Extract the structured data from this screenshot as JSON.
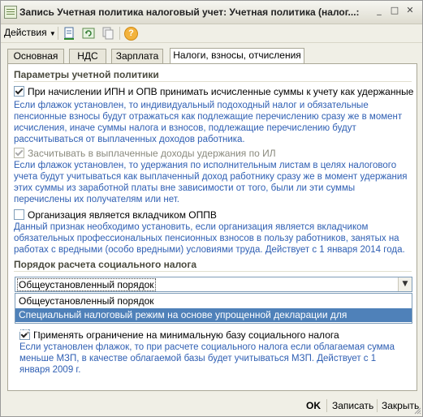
{
  "window": {
    "title": "Запись Учетная политика налоговый учет: Учетная политика (налог...:"
  },
  "toolbar": {
    "actions_label": "Действия"
  },
  "tabs": [
    {
      "label": "Основная",
      "active": false
    },
    {
      "label": "НДС",
      "active": false
    },
    {
      "label": "Зарплата",
      "active": false
    },
    {
      "label": "Налоги, взносы, отчисления",
      "active": true
    }
  ],
  "policy": {
    "section_title": "Параметры учетной политики",
    "ipn_checkbox": {
      "label": "При начислении ИПН и ОПВ принимать исчисленные суммы к учету как удержанные",
      "checked": true
    },
    "ipn_hint": [
      "Если флажок установлен, то индивидуальный подоходный налог и обязательные",
      "пенсионные взносы будут отражаться как подлежащие перечислению сразу же в момент",
      "исчисления, иначе суммы налога и взносов, подлежащие перечислению будут",
      "рассчитываться от выплаченных доходов работника."
    ],
    "il_checkbox": {
      "label": "Засчитывать в выплаченные доходы удержания по ИЛ",
      "checked": true
    },
    "il_hint": [
      "Если флажок установлен, то удержания по исполнительным листам в целях налогового",
      "учета будут учитываться как выплаченный доход работнику сразу же в момент удержания",
      "этих суммы из заработной платы вне зависимости от того, были ли эти суммы",
      "перечислены их получателям или нет."
    ],
    "oppv_checkbox": {
      "label": "Организация является вкладчиком ОППВ",
      "checked": false
    },
    "oppv_hint": [
      "Данный признак необходимо установить, если организация является вкладчиком",
      "обязательных профессиональных пенсионных взносов в пользу работников, занятых на",
      "работах с вредными (особо вредными) условиями труда. Действует с 1 января 2014 года."
    ]
  },
  "social": {
    "section_title": "Порядок расчета социального налога",
    "combo_value": "Общеустановленный порядок",
    "options": [
      "Общеустановленный порядок",
      "Специальный налоговый режим на основе упрощенной декларации для юридического лица"
    ],
    "selected_option_index": 1,
    "min_base_checkbox": {
      "label": "Применять ограничение на минимальную базу социального налога",
      "checked": true
    },
    "min_base_hint": [
      "Если установлен флажок, то при расчете социального налога если облагаемая сумма",
      "меньше МЗП, в качестве облагаемой базы будет учитываться МЗП. Действует с 1",
      "января 2009 г."
    ]
  },
  "footer": {
    "ok_label": "OK",
    "save_label": "Записать",
    "close_label": "Закрыть"
  },
  "colors": {
    "hint_text": "#2f5fb3",
    "selected_option_bg": "#4f81b9",
    "help_icon": "#f3b33d"
  }
}
